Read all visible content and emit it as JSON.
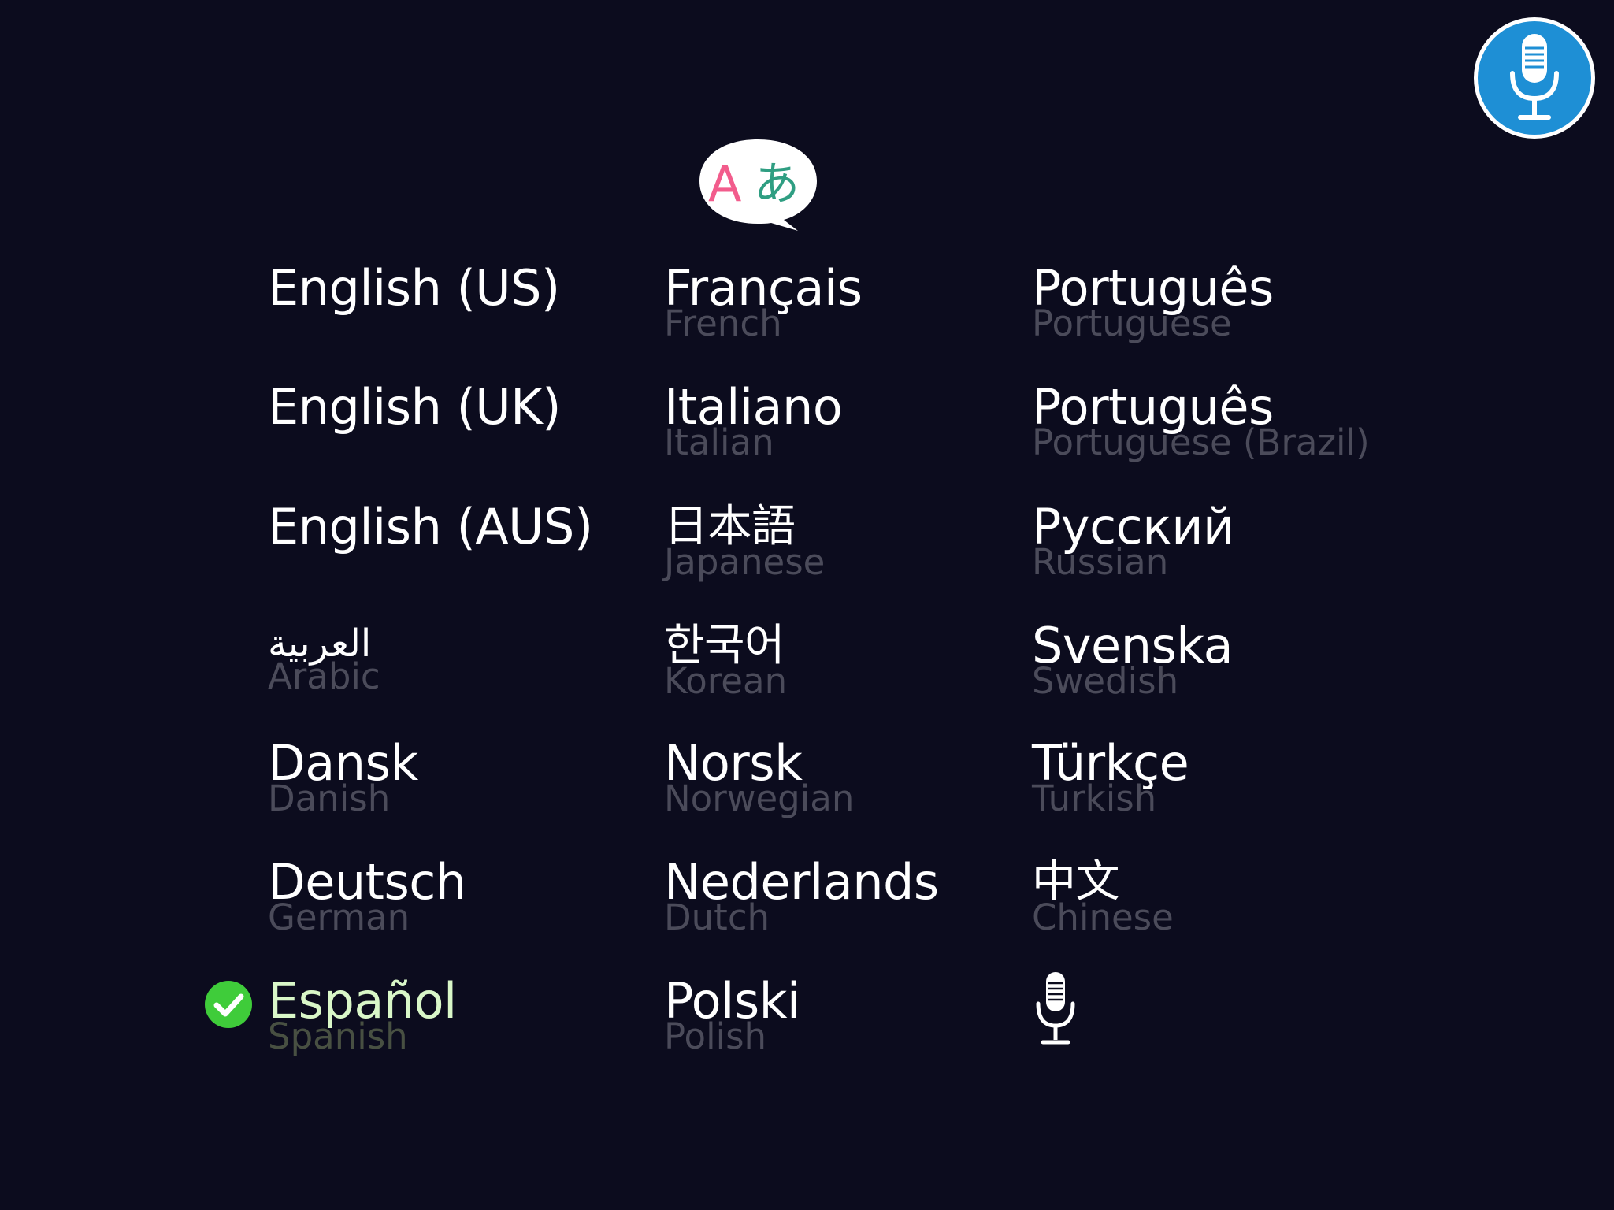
{
  "header": {
    "translate_icon": "translate-speech-bubble-icon",
    "bubble_latin": "A",
    "bubble_kana": "あ",
    "mic_button_icon": "microphone-icon"
  },
  "colors": {
    "background": "#0c0c1e",
    "mic_button": "#1e8fd5",
    "bubble_latin": "#f25c8c",
    "bubble_kana": "#2f9e82",
    "check": "#3fcc3a",
    "selected_text": "#d9f7c8",
    "subtitle": "#4b4b5a"
  },
  "languages": {
    "col1": [
      {
        "native": "English (US)",
        "english": ""
      },
      {
        "native": "English (UK)",
        "english": ""
      },
      {
        "native": "English (AUS)",
        "english": ""
      },
      {
        "native": "العربية",
        "english": "Arabic"
      },
      {
        "native": "Dansk",
        "english": "Danish"
      },
      {
        "native": "Deutsch",
        "english": "German"
      },
      {
        "native": "Español",
        "english": "Spanish",
        "selected": true
      }
    ],
    "col2": [
      {
        "native": "Français",
        "english": "French"
      },
      {
        "native": "Italiano",
        "english": "Italian"
      },
      {
        "native": "日本語",
        "english": "Japanese"
      },
      {
        "native": "한국어",
        "english": "Korean"
      },
      {
        "native": "Norsk",
        "english": "Norwegian"
      },
      {
        "native": "Nederlands",
        "english": "Dutch"
      },
      {
        "native": "Polski",
        "english": "Polish"
      }
    ],
    "col3": [
      {
        "native": "Português",
        "english": "Portuguese"
      },
      {
        "native": "Português",
        "english": "Portuguese (Brazil)"
      },
      {
        "native": "Русский",
        "english": "Russian"
      },
      {
        "native": "Svenska",
        "english": "Swedish"
      },
      {
        "native": "Türkçe",
        "english": "Turkish"
      },
      {
        "native": "中文",
        "english": "Chinese"
      }
    ]
  },
  "extra_item_icon": "microphone-icon",
  "selected_icon": "check-circle-icon"
}
